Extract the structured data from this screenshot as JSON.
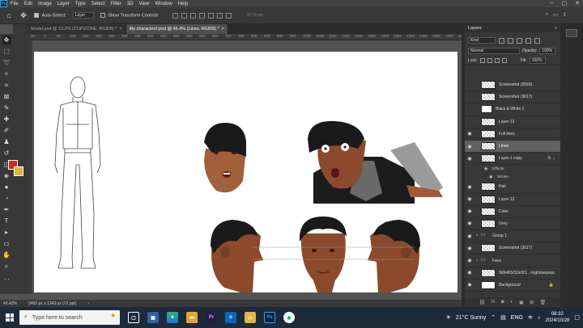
{
  "menubar": {
    "app_logo": "Ps",
    "items": [
      "File",
      "Edit",
      "Image",
      "Layer",
      "Type",
      "Select",
      "Filter",
      "3D",
      "View",
      "Window",
      "Help"
    ]
  },
  "options": {
    "auto_select_label": "Auto-Select:",
    "auto_select_value": "Layer",
    "transform_label": "Show Transform Controls",
    "mode_3d": "3D Mode:"
  },
  "tabs": [
    {
      "label": "Model.psd @ 13.2% (CUPIZONE, RGB/8) *",
      "active": false
    },
    {
      "label": "My character2.psd @ 45.4% (Lines, RGB/8) *",
      "active": true
    }
  ],
  "ruler_top": [
    "50",
    "0",
    "50",
    "100",
    "150",
    "200",
    "250",
    "300",
    "350",
    "400",
    "450",
    "500",
    "550",
    "600",
    "650",
    "700",
    "750",
    "800",
    "850",
    "900",
    "950",
    "1000",
    "1050",
    "1100",
    "1150",
    "1200",
    "1250",
    "1300",
    "1350",
    "1400",
    "1450",
    "1500",
    "1550",
    "1600"
  ],
  "status": {
    "zoom": "45.42%",
    "doc_size": "2482 px x 1243 px (72 ppi)"
  },
  "layers_panel": {
    "title": "Layers",
    "kind": "Kind",
    "blend": "Normal",
    "opacity_label": "Opacity:",
    "opacity": "100%",
    "lock_label": "Lock:",
    "fill_label": "Fill:",
    "fill": "100%",
    "layers": [
      {
        "name": "Screenshot (3593)",
        "visible": false,
        "thumb": "image",
        "indent": 1
      },
      {
        "name": "Screenshot (3617)",
        "visible": false,
        "thumb": "check",
        "indent": 1
      },
      {
        "name": "Black & White 1",
        "visible": false,
        "thumb": "adjust",
        "indent": 1
      },
      {
        "name": "Layer 13",
        "visible": false,
        "thumb": "check",
        "indent": 1
      },
      {
        "name": "Full lines",
        "visible": true,
        "thumb": "check",
        "indent": 1
      },
      {
        "name": "Lines",
        "visible": true,
        "thumb": "check",
        "indent": 1,
        "selected": true
      },
      {
        "name": "Layer 1 copy",
        "visible": true,
        "thumb": "check",
        "indent": 1,
        "fx": true
      },
      {
        "name": "Hair",
        "visible": true,
        "thumb": "check",
        "indent": 1
      },
      {
        "name": "Layer 12",
        "visible": true,
        "thumb": "check",
        "indent": 1
      },
      {
        "name": "Color",
        "visible": true,
        "thumb": "check",
        "indent": 1
      },
      {
        "name": "Grey",
        "visible": true,
        "thumb": "check",
        "indent": 1
      },
      {
        "name": "Group 1",
        "visible": true,
        "thumb": "folder",
        "indent": 0
      },
      {
        "name": "Screenshot (3517)",
        "visible": true,
        "thumb": "check",
        "indent": 1
      },
      {
        "name": "Face",
        "visible": true,
        "thumb": "folder",
        "indent": 0
      },
      {
        "name": "9d9483c52e3f1...-highrisepxaa",
        "visible": true,
        "thumb": "image",
        "indent": 1
      },
      {
        "name": "Background",
        "visible": true,
        "thumb": "white",
        "indent": 1,
        "italic": true,
        "locked": true
      }
    ],
    "effects_label": "Effects",
    "stroke_label": "Stroke"
  },
  "taskbar": {
    "search_placeholder": "Type here to search",
    "weather": "21°C  Sunny",
    "lang": "ENG",
    "time": "08:32",
    "date": "2024/10/28"
  },
  "colors": {
    "foreground": "#e0211c",
    "background": "#e2b43a",
    "skin": "#8b4a2b",
    "hair": "#1a1a1a"
  }
}
